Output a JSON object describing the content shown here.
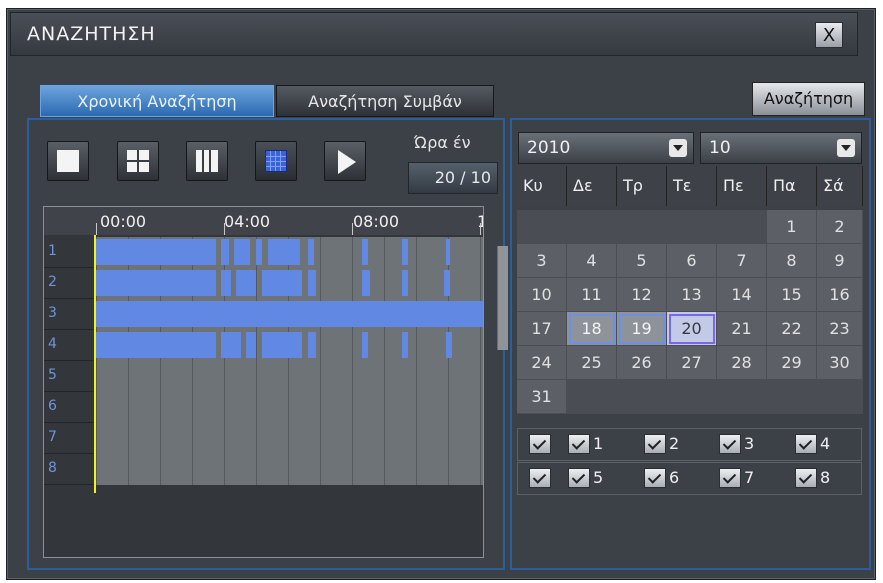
{
  "title": "ΑΝΑΖΗΤΗΣΗ",
  "close_label": "X",
  "tabs": [
    {
      "label": "Χρονική Αναζήτηση",
      "active": true
    },
    {
      "label": "Αναζήτηση Συμβάν",
      "active": false
    }
  ],
  "search_button": "Αναζήτηση",
  "toolbar": {
    "buttons": [
      "layout-1-icon",
      "layout-4-icon",
      "layout-9-icon",
      "layout-16-icon",
      "play-icon"
    ]
  },
  "time_label": "Ώρα έν",
  "date_value": "20 / 10",
  "timeline": {
    "hours": [
      "00:00",
      "04:00",
      "08:00",
      "1"
    ],
    "channels": [
      "1",
      "2",
      "3",
      "4",
      "5",
      "6",
      "7",
      "8"
    ],
    "cursor_time": "00:00",
    "recording_color": "#6189e3"
  },
  "calendar": {
    "year": "2010",
    "month": "10",
    "weekdays": [
      "Κυ",
      "Δε",
      "Τρ",
      "Τε",
      "Πε",
      "Πα",
      "Σά"
    ],
    "weeks": [
      [
        "",
        "",
        "",
        "",
        "",
        "1",
        "2"
      ],
      [
        "3",
        "4",
        "5",
        "6",
        "7",
        "8",
        "9"
      ],
      [
        "10",
        "11",
        "12",
        "13",
        "14",
        "15",
        "16"
      ],
      [
        "17",
        "18",
        "19",
        "20",
        "21",
        "22",
        "23"
      ],
      [
        "24",
        "25",
        "26",
        "27",
        "28",
        "29",
        "30"
      ],
      [
        "31",
        "",
        "",
        "",
        "",
        "",
        ""
      ]
    ],
    "days_with_recordings": [
      "18",
      "19"
    ],
    "selected_day": "20"
  },
  "channel_checks": {
    "rows": [
      {
        "all": true,
        "items": [
          {
            "label": "1",
            "checked": true
          },
          {
            "label": "2",
            "checked": true
          },
          {
            "label": "3",
            "checked": true
          },
          {
            "label": "4",
            "checked": true
          }
        ]
      },
      {
        "all": true,
        "items": [
          {
            "label": "5",
            "checked": true
          },
          {
            "label": "6",
            "checked": true
          },
          {
            "label": "7",
            "checked": true
          },
          {
            "label": "8",
            "checked": true
          }
        ]
      }
    ]
  }
}
